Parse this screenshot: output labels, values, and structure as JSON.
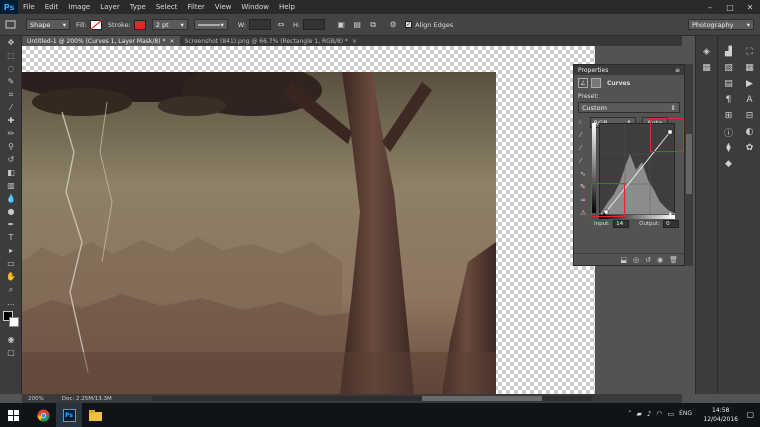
{
  "app": {
    "logo": "Ps"
  },
  "menu": [
    "File",
    "Edit",
    "Image",
    "Layer",
    "Type",
    "Select",
    "Filter",
    "View",
    "Window",
    "Help"
  ],
  "window_controls": [
    "–",
    "□",
    "✕"
  ],
  "options_bar": {
    "mode": "Shape",
    "fill_label": "Fill:",
    "stroke_label": "Stroke:",
    "stroke_color": "#e0282a",
    "stroke_width": "2 pt",
    "w_label": "W:",
    "h_label": "H:",
    "align_edges": "Align Edges",
    "workspace": "Photography"
  },
  "tabs": [
    {
      "label": "Untitled-1 @ 200% (Curves 1, Layer Mask/8) *",
      "active": true
    },
    {
      "label": "Screenshot (841).png @ 66.7% (Rectangle 1, RGB/8) *",
      "active": false
    }
  ],
  "status": {
    "zoom": "200%",
    "doc": "Doc: 2.25M/13.3M"
  },
  "properties": {
    "panel_title": "Properties",
    "adjustment": "Curves",
    "preset_label": "Preset:",
    "preset_value": "Custom",
    "channel": "RGB",
    "auto_label": "Auto",
    "input_label": "Input:",
    "input_value": "14",
    "output_label": "Output:",
    "output_value": "0"
  },
  "taskbar": {
    "lang": "ENG",
    "time": "14:58",
    "date": "12/04/2016"
  }
}
